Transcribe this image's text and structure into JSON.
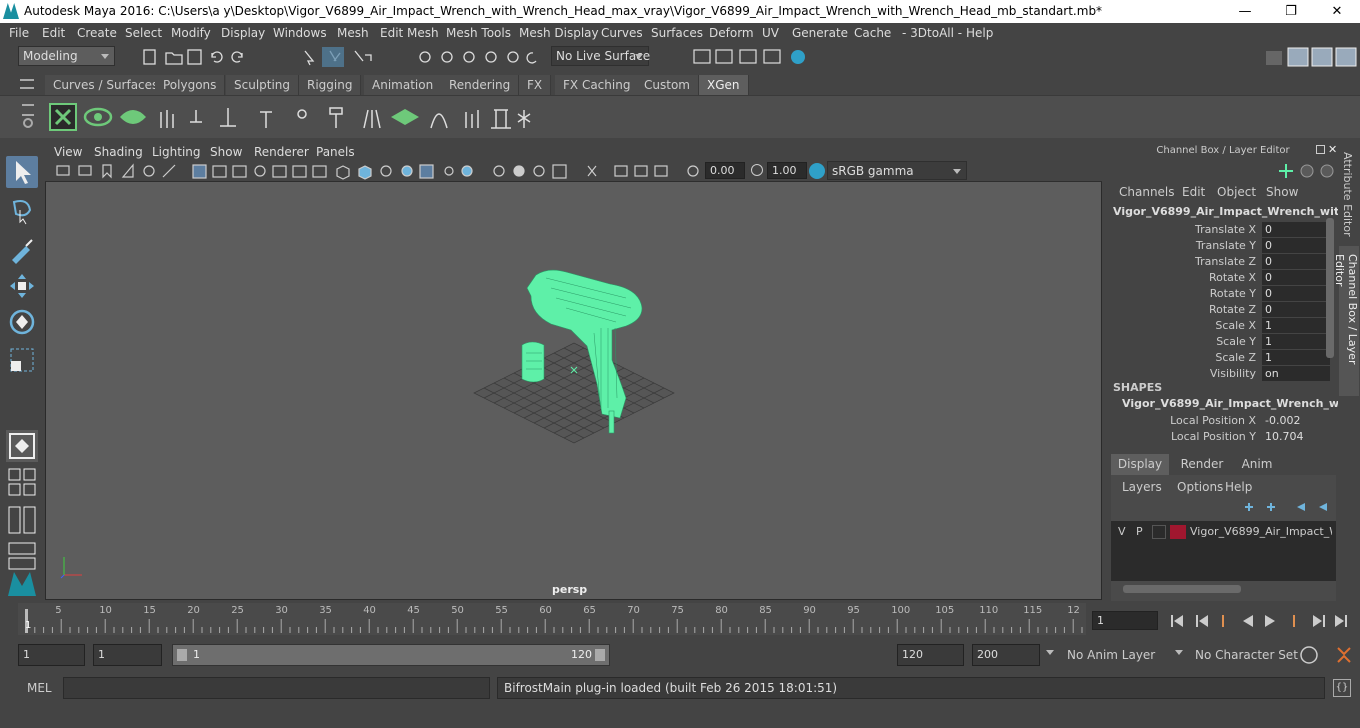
{
  "titlebar": {
    "title": "Autodesk Maya 2016: C:\\Users\\a y\\Desktop\\Vigor_V6899_Air_Impact_Wrench_with_Wrench_Head_max_vray\\Vigor_V6899_Air_Impact_Wrench_with_Wrench_Head_mb_standart.mb*",
    "minimize": "—",
    "maximize": "❐",
    "close": "✕"
  },
  "menubar": [
    "File",
    "Edit",
    "Create",
    "Select",
    "Modify",
    "Display",
    "Windows",
    "Mesh",
    "Edit Mesh",
    "Mesh Tools",
    "Mesh Display",
    "Curves",
    "Surfaces",
    "Deform",
    "UV",
    "Generate",
    "Cache",
    "- 3DtoAll -",
    "Help"
  ],
  "statusline": {
    "mode": "Modeling",
    "live_surface": "No Live Surface"
  },
  "shelf_tabs": [
    {
      "label": "Curves / Surfaces",
      "active": false
    },
    {
      "label": "Polygons",
      "active": false
    },
    {
      "label": "Sculpting",
      "active": false
    },
    {
      "label": "Rigging",
      "active": false
    },
    {
      "label": "Animation",
      "active": false
    },
    {
      "label": "Rendering",
      "active": false
    },
    {
      "label": "FX",
      "active": false
    },
    {
      "label": "FX Caching",
      "active": false
    },
    {
      "label": "Custom",
      "active": false
    },
    {
      "label": "XGen",
      "active": true
    }
  ],
  "viewport": {
    "menu": [
      "View",
      "Shading",
      "Lighting",
      "Show",
      "Renderer",
      "Panels"
    ],
    "exposure": "0.00",
    "gamma": "1.00",
    "color_space": "sRGB gamma",
    "camera_label": "persp",
    "wire_color": "#5ef0a8"
  },
  "channel_box": {
    "title": "Channel Box / Layer Editor",
    "menu": [
      "Channels",
      "Edit",
      "Object",
      "Show"
    ],
    "object_name": "Vigor_V6899_Air_Impact_Wrench_with...",
    "channels": [
      {
        "label": "Translate X",
        "value": "0"
      },
      {
        "label": "Translate Y",
        "value": "0"
      },
      {
        "label": "Translate Z",
        "value": "0"
      },
      {
        "label": "Rotate X",
        "value": "0"
      },
      {
        "label": "Rotate Y",
        "value": "0"
      },
      {
        "label": "Rotate Z",
        "value": "0"
      },
      {
        "label": "Scale X",
        "value": "1"
      },
      {
        "label": "Scale Y",
        "value": "1"
      },
      {
        "label": "Scale Z",
        "value": "1"
      },
      {
        "label": "Visibility",
        "value": "on"
      }
    ],
    "shapes_header": "SHAPES",
    "shape_name": "Vigor_V6899_Air_Impact_Wrench_wi...",
    "shape_channels": [
      {
        "label": "Local Position X",
        "value": "-0.002"
      },
      {
        "label": "Local Position Y",
        "value": "10.704"
      }
    ]
  },
  "layer_editor": {
    "tabs": [
      {
        "label": "Display",
        "active": true
      },
      {
        "label": "Render",
        "active": false
      },
      {
        "label": "Anim",
        "active": false
      }
    ],
    "menu": [
      "Layers",
      "Options",
      "Help"
    ],
    "layer": {
      "v": "V",
      "p": "P",
      "name": "Vigor_V6899_Air_Impact_Wr",
      "color": "#a0172f"
    }
  },
  "side_tabs": {
    "attribute_editor": "Attribute Editor",
    "channel_box": "Channel Box / Layer Editor"
  },
  "timeline": {
    "ticks": [
      "5",
      "10",
      "15",
      "20",
      "25",
      "30",
      "35",
      "40",
      "45",
      "50",
      "55",
      "60",
      "65",
      "70",
      "75",
      "80",
      "85",
      "90",
      "95",
      "100",
      "105",
      "110",
      "115",
      "12"
    ],
    "current_frame_marker": "1",
    "current_frame": "1"
  },
  "range": {
    "start": "1",
    "playback_start": "1",
    "slider_start": "1",
    "slider_end": "120",
    "playback_end": "120",
    "end": "200",
    "anim_layer": "No Anim Layer",
    "character_set": "No Character Set"
  },
  "command_line": {
    "lang": "MEL",
    "result": "BifrostMain plug-in loaded (built Feb 26 2015 18:01:51)"
  }
}
